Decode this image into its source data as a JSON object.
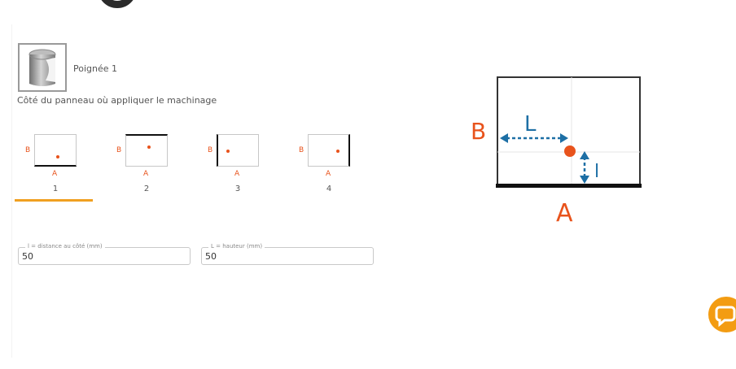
{
  "product": {
    "name": "Poignée 1"
  },
  "section": {
    "label": "Côté du panneau où appliquer le machinage"
  },
  "side_options": [
    {
      "number": "1",
      "mark_a": "A",
      "mark_b": "B",
      "selected": true
    },
    {
      "number": "2",
      "mark_a": "A",
      "mark_b": "B",
      "selected": false
    },
    {
      "number": "3",
      "mark_a": "A",
      "mark_b": "B",
      "selected": false
    },
    {
      "number": "4",
      "mark_a": "A",
      "mark_b": "B",
      "selected": false
    }
  ],
  "fields": {
    "distance": {
      "legend": "l = distance au côté (mm)",
      "value": "50"
    },
    "height": {
      "legend": "L = hauteur (mm)",
      "value": "50"
    }
  },
  "diagram": {
    "label_b": "B",
    "label_l_big": "L",
    "label_l_small": "l",
    "label_a": "A"
  },
  "colors": {
    "accent": "#f0a020",
    "marker": "#e8531c",
    "arrow": "#1d6fa5",
    "chat": "#f39c12"
  },
  "icons": {
    "product": "handle-icon",
    "chat": "chat-icon"
  }
}
